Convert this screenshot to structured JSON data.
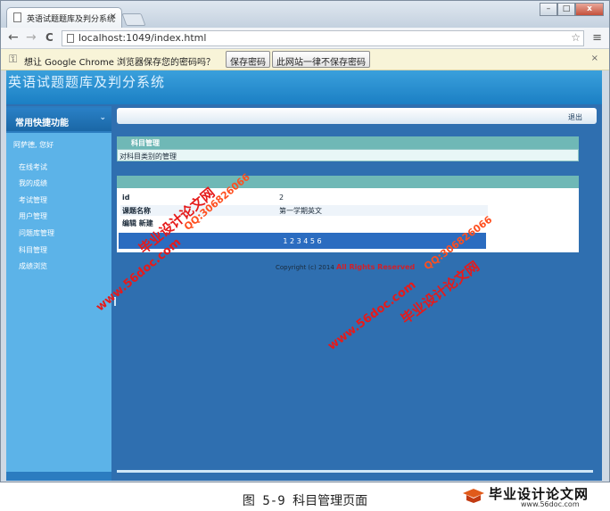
{
  "browser": {
    "tab_title": "英语试题题库及判分系统",
    "tab_close": "×",
    "window_buttons": {
      "minimize": "–",
      "maximize": "□",
      "close": "x"
    },
    "nav": {
      "back": "←",
      "forward": "→",
      "reload": "C"
    },
    "address": "localhost:1049/index.html",
    "bookmark_star": "☆",
    "menu": "≡"
  },
  "infobar": {
    "icon": "key-icon",
    "message": "想让 Google Chrome 浏览器保存您的密码吗？",
    "save_button": "保存密码",
    "never_button": "此网站一律不保存密码",
    "close": "×"
  },
  "page": {
    "site_title": "英语试题题库及判分系统",
    "sidebar": {
      "header": "常用快捷功能",
      "header_chevron": "⌄",
      "greeting": "阿萨德, 您好",
      "items": [
        "在线考试",
        "我的成绩",
        "考试管理",
        "用户管理",
        "问题库管理",
        "科目管理",
        "成绩浏览"
      ]
    },
    "logout": "退出",
    "section": {
      "title": "科目管理",
      "description": "对科目类别的管理"
    },
    "record": {
      "id_label": "id",
      "id_value": "2",
      "name_label": "课题名称",
      "name_value": "第一学期英文",
      "actions": "编辑 新建"
    },
    "pager": "1 2 3 4 5 6",
    "copyright": "Copyright (c) 2014",
    "rights": "All Rights Reserved"
  },
  "watermarks": {
    "brand": "毕业设计论文网",
    "site": "www.56doc.com",
    "qq": "QQ:306826066"
  },
  "caption": "图 5-9 科目管理页面",
  "logo": {
    "name": "毕业设计论文网",
    "url": "www.56doc.com"
  },
  "colors": {
    "header_blue": "#1b7fc4",
    "page_bg": "#2f6fb0",
    "panel_head_teal": "#6fb8b6",
    "sidebar_light": "#5cb3e8",
    "watermark_red": "#e61a1a",
    "rights_red": "#d0202a"
  }
}
